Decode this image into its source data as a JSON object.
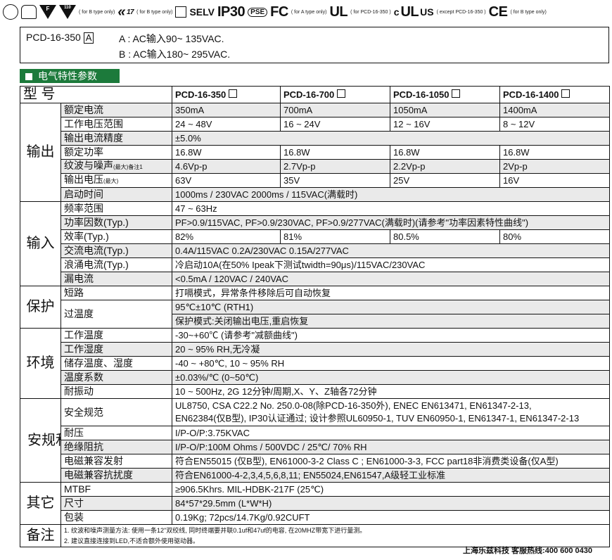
{
  "cert_bar": {
    "items": [
      {
        "name": "cert-circle-icon"
      },
      {
        "name": "cert-house-icon"
      },
      {
        "name": "cert-f-triangle-icon",
        "text": "F"
      },
      {
        "name": "cert-110-triangle-icon",
        "text": "110"
      }
    ],
    "b_type_only": "( for B type only)",
    "mark17": "17",
    "selv": "SELV",
    "ip30": "IP30",
    "pse": "PSE",
    "fc": "FC",
    "a_type_only": "( for A type only)",
    "ul": "UL",
    "pcd16350": "( for PCD-16-350 )",
    "c": "c",
    "us": "US",
    "except": "( except PCD-16-350 )",
    "ce": "CE",
    "b_type_only2": "( for B type only)"
  },
  "model_info": {
    "model": "PCD-16-350",
    "box": "A",
    "line_a": "A : AC输入90~ 135VAC.",
    "line_b": "B : AC输入180~ 295VAC."
  },
  "section_title": "电气特性参数",
  "table": {
    "model_label": "型  号",
    "models": [
      "PCD-16-350",
      "PCD-16-700",
      "PCD-16-1050",
      "PCD-16-1400"
    ],
    "output": {
      "cat": "输出",
      "rows": [
        {
          "label": "额定电流",
          "vals": [
            "350mA",
            "700mA",
            "1050mA",
            "1400mA"
          ]
        },
        {
          "label": "工作电压范围",
          "vals": [
            "24 ~ 48V",
            "16 ~ 24V",
            "12 ~ 16V",
            "8 ~ 12V"
          ]
        },
        {
          "label": "输出电流精度",
          "span": "±5.0%"
        },
        {
          "label": "额定功率",
          "vals": [
            "16.8W",
            "16.8W",
            "16.8W",
            "16.8W"
          ]
        },
        {
          "label": "纹波与噪声",
          "sub": "(最大)备注1",
          "vals": [
            "4.6Vp-p",
            "2.7Vp-p",
            "2.2Vp-p",
            "2Vp-p"
          ]
        },
        {
          "label": "输出电压",
          "sub": "(最大)",
          "vals": [
            "63V",
            "35V",
            "25V",
            "16V"
          ]
        },
        {
          "label": "启动时间",
          "span": "1000ms / 230VAC    2000ms / 115VAC(满载时)"
        }
      ]
    },
    "input": {
      "cat": "输入",
      "rows": [
        {
          "label": "频率范围",
          "span": "47 ~ 63Hz"
        },
        {
          "label": "功率因数(Typ.)",
          "span": "PF>0.9/115VAC, PF>0.9/230VAC, PF>0.9/277VAC(满载时)(请参考\"功率因素特性曲线\")"
        },
        {
          "label": "效率(Typ.)",
          "vals": [
            "82%",
            "81%",
            "80.5%",
            "80%"
          ]
        },
        {
          "label": "交流电流(Typ.)",
          "span": "0.4A/115VAC    0.2A/230VAC    0.15A/277VAC"
        },
        {
          "label": "浪涌电流(Typ.)",
          "span": "冷启动10A(在50% Ipeak下测试twidth=90μs)/115VAC/230VAC"
        },
        {
          "label": "漏电流",
          "span": "<0.5mA / 120VAC / 240VAC"
        }
      ]
    },
    "protection": {
      "cat": "保护",
      "short_label": "短路",
      "short_val": "打嗝模式，异常条件移除后可自动恢复",
      "ot_label": "过温度",
      "ot_val1": "95℃±10℃ (RTH1)",
      "ot_val2": "保护模式:关闭输出电压,重启恢复"
    },
    "env": {
      "cat": "环境",
      "rows": [
        {
          "label": "工作温度",
          "span": "-30~+60℃ (请参考\"减额曲线\")"
        },
        {
          "label": "工作湿度",
          "span": "20 ~ 95% RH,无冷凝"
        },
        {
          "label": "储存温度、湿度",
          "span": "-40 ~ +80℃, 10 ~ 95% RH"
        },
        {
          "label": "温度系数",
          "span": "±0.03%/℃ (0~50℃)"
        },
        {
          "label": "耐振动",
          "span": "10 ~ 500Hz, 2G 12分钟/周期,X、Y、Z轴各72分钟"
        }
      ]
    },
    "safety": {
      "cat": "安规和电磁兼容",
      "rows": [
        {
          "label": "安全规范",
          "line1": "UL8750, CSA C22.2 No. 250.0-08(除PCD-16-350外), ENEC EN613471, EN61347-2-13,",
          "line2": "EN62384(仅B型), IP30认证通过; 设计参照UL60950-1, TUV EN60950-1, EN61347-1, EN61347-2-13"
        },
        {
          "label": "耐压",
          "span": "I/P-O/P:3.75KVAC"
        },
        {
          "label": "绝缘阻抗",
          "span": "I/P-O/P:100M Ohms / 500VDC / 25℃/ 70% RH"
        },
        {
          "label": "电磁兼容发射",
          "span": "符合EN55015 (仅B型), EN61000-3-2 Class C ; EN61000-3-3, FCC part18非消费类设备(仅A型)"
        },
        {
          "label": "电磁兼容抗扰度",
          "span": "符合EN61000-4-2,3,4,5,6,8,11; EN55024,EN61547,A级轻工业标准"
        }
      ]
    },
    "others": {
      "cat": "其它",
      "rows": [
        {
          "label": "MTBF",
          "span": "≥906.5Khrs.    MIL-HDBK-217F (25℃)"
        },
        {
          "label": "尺寸",
          "span": "84*57*29.5mm (L*W*H)"
        },
        {
          "label": "包装",
          "span": "0.19Kg; 72pcs/14.7Kg/0.92CUFT"
        }
      ]
    },
    "notes": {
      "cat": "备注",
      "n1": "1. 纹波和噪声测量方法: 使用一条12\"双绞线, 同时终端要并联0.1uf和47uf的电容, 在20MHZ带宽下进行量测。",
      "n2": "2. 建议直接连接到LED,不适合额外使用驱动器。"
    }
  },
  "hotline": "上海乐兹科技 客服热线:400 600 0430"
}
